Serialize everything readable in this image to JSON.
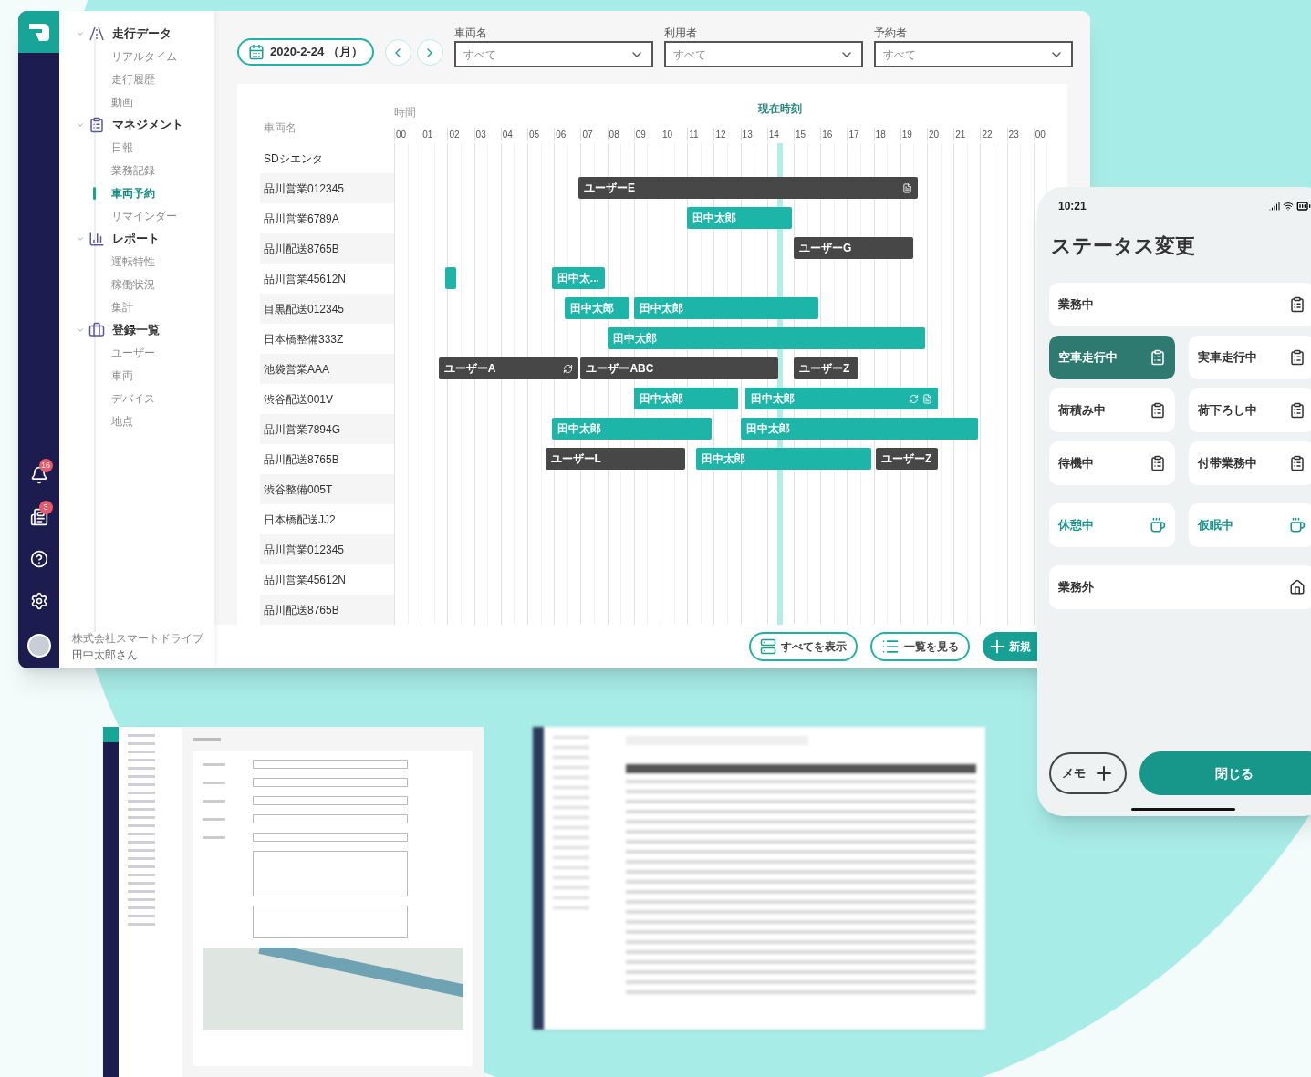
{
  "rail": {
    "badges": [
      {
        "kind": "bell",
        "count": "16"
      },
      {
        "kind": "news",
        "count": "3"
      }
    ]
  },
  "nav": [
    {
      "label": "走行データ",
      "expanded": true,
      "children": [
        {
          "label": "リアルタイム",
          "selected": false
        },
        {
          "label": "走行履歴",
          "selected": false
        },
        {
          "label": "動画",
          "selected": false
        }
      ]
    },
    {
      "label": "マネジメント",
      "expanded": true,
      "children": [
        {
          "label": "日報",
          "selected": false
        },
        {
          "label": "業務記録",
          "selected": false
        },
        {
          "label": "車両予約",
          "selected": true
        },
        {
          "label": "リマインダー",
          "selected": false
        }
      ]
    },
    {
      "label": "レポート",
      "expanded": true,
      "children": [
        {
          "label": "運転特性",
          "selected": false
        },
        {
          "label": "稼働状況",
          "selected": false
        },
        {
          "label": "集計",
          "selected": false
        }
      ]
    },
    {
      "label": "登録一覧",
      "expanded": true,
      "children": [
        {
          "label": "ユーザー",
          "selected": false
        },
        {
          "label": "車両",
          "selected": false
        },
        {
          "label": "デバイス",
          "selected": false
        },
        {
          "label": "地点",
          "selected": false
        }
      ]
    }
  ],
  "footer": {
    "company": "株式会社スマートドライブ",
    "user": "田中太郎さん"
  },
  "toolbar": {
    "date": "2020-2-24 （月）",
    "filters": [
      {
        "label": "車両名",
        "value": "すべて"
      },
      {
        "label": "利用者",
        "value": "すべて"
      },
      {
        "label": "予約者",
        "value": "すべて"
      }
    ]
  },
  "schedule": {
    "name_header": "車両名",
    "time_header": "時間",
    "now_label": "現在時刻",
    "hours": [
      "00",
      "01",
      "02",
      "03",
      "04",
      "05",
      "06",
      "07",
      "08",
      "09",
      "10",
      "11",
      "12",
      "13",
      "14",
      "15",
      "16",
      "17",
      "18",
      "19",
      "20",
      "21",
      "22",
      "23",
      "00"
    ],
    "rows": [
      {
        "vehicle": "SDシエンタ"
      },
      {
        "vehicle": "品川営業012345",
        "bookings": [
          {
            "label": "ユーザーE",
            "color": "#474747",
            "recurring": false,
            "has_file": true
          }
        ]
      },
      {
        "vehicle": "品川営業6789A",
        "bookings": [
          {
            "label": "田中太郎",
            "color": "#1db5a8",
            "recurring": false,
            "has_file": false
          }
        ]
      },
      {
        "vehicle": "品川配送8765B",
        "bookings": [
          {
            "label": "ユーザーG",
            "color": "#474747",
            "recurring": false,
            "has_file": false
          }
        ]
      },
      {
        "vehicle": "品川営業45612N",
        "bookings": [
          {
            "color": "#1db5a8",
            "recurring": false,
            "has_file": false
          },
          {
            "label": "田中太...",
            "color": "#1db5a8",
            "recurring": false,
            "has_file": false
          }
        ]
      },
      {
        "vehicle": "目黒配送012345",
        "bookings": [
          {
            "label": "田中太郎",
            "color": "#1db5a8",
            "recurring": false,
            "has_file": false
          },
          {
            "label": "田中太郎",
            "color": "#1db5a8",
            "recurring": false,
            "has_file": false
          }
        ]
      },
      {
        "vehicle": "日本橋整備333Z",
        "bookings": [
          {
            "label": "田中太郎",
            "color": "#1db5a8",
            "recurring": false,
            "has_file": false
          }
        ]
      },
      {
        "vehicle": "池袋営業AAA",
        "bookings": [
          {
            "label": "ユーザーA",
            "color": "#474747",
            "recurring": true,
            "has_file": false
          },
          {
            "label": "ユーザーABC",
            "color": "#474747",
            "recurring": false,
            "has_file": false
          },
          {
            "label": "ユーザーZ",
            "color": "#474747",
            "recurring": false,
            "has_file": false
          }
        ]
      },
      {
        "vehicle": "渋谷配送001V",
        "bookings": [
          {
            "label": "田中太郎",
            "color": "#1db5a8",
            "recurring": false,
            "has_file": false
          },
          {
            "label": "田中太郎",
            "color": "#1db5a8",
            "recurring": true,
            "has_file": true
          }
        ]
      },
      {
        "vehicle": "品川営業7894G",
        "bookings": [
          {
            "label": "田中太郎",
            "color": "#1db5a8",
            "recurring": false,
            "has_file": false
          },
          {
            "label": "田中太郎",
            "color": "#1db5a8",
            "recurring": false,
            "has_file": false
          }
        ]
      },
      {
        "vehicle": "品川配送8765B",
        "bookings": [
          {
            "label": "ユーザーL",
            "color": "#474747",
            "recurring": false,
            "has_file": false
          },
          {
            "label": "田中太郎",
            "color": "#1db5a8",
            "recurring": false,
            "has_file": false
          },
          {
            "label": "ユーザーZ",
            "color": "#474747",
            "recurring": false,
            "has_file": false
          }
        ]
      },
      {
        "vehicle": "渋谷整備005T"
      },
      {
        "vehicle": "日本橋配送JJ2"
      },
      {
        "vehicle": "品川営業012345"
      },
      {
        "vehicle": "品川営業45612N"
      },
      {
        "vehicle": "品川配送8765B"
      }
    ]
  },
  "actions": [
    {
      "label": "すべてを表示",
      "kind": "all"
    },
    {
      "label": "一覧を見る",
      "kind": "list"
    },
    {
      "label": "新規",
      "kind": "new"
    }
  ],
  "phone": {
    "time": "10:21",
    "title": "ステータス変更",
    "sections": [
      {
        "rows": [
          [
            {
              "label": "業務中",
              "kind": "work",
              "selected": false
            }
          ],
          [
            {
              "label": "空車走行中",
              "kind": "work",
              "selected": true
            },
            {
              "label": "実車走行中",
              "kind": "work",
              "selected": false
            }
          ],
          [
            {
              "label": "荷積み中",
              "kind": "work",
              "selected": false
            },
            {
              "label": "荷下ろし中",
              "kind": "work",
              "selected": false
            }
          ],
          [
            {
              "label": "待機中",
              "kind": "work",
              "selected": false
            },
            {
              "label": "付帯業務中",
              "kind": "work",
              "selected": false
            }
          ]
        ]
      },
      {
        "rows": [
          [
            {
              "label": "休憩中",
              "kind": "rest",
              "selected": false
            },
            {
              "label": "仮眠中",
              "kind": "rest",
              "selected": false
            }
          ]
        ]
      },
      {
        "rows": [
          [
            {
              "label": "業務外",
              "kind": "off",
              "selected": false
            }
          ]
        ]
      }
    ],
    "memo_button": "メモ",
    "close_button": "閉じる"
  }
}
